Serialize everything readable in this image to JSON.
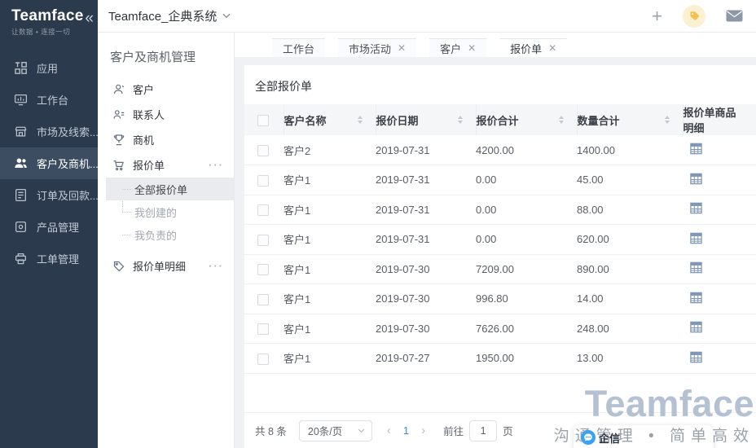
{
  "brand": {
    "logo": "Teamface",
    "tagline": "让数据 • 连接一切"
  },
  "topbar": {
    "title": "Teamface_企典系统"
  },
  "sidebar": {
    "items": [
      {
        "label": "应用",
        "icon": "apps-icon",
        "active": false
      },
      {
        "label": "工作台",
        "icon": "workbench-icon",
        "active": false
      },
      {
        "label": "市场及线索...",
        "icon": "market-icon",
        "active": false
      },
      {
        "label": "客户及商机...",
        "icon": "customers-icon",
        "active": true
      },
      {
        "label": "订单及回款...",
        "icon": "orders-icon",
        "active": false
      },
      {
        "label": "产品管理",
        "icon": "products-icon",
        "active": false
      },
      {
        "label": "工单管理",
        "icon": "tickets-icon",
        "active": false
      }
    ]
  },
  "submenu": {
    "title": "客户及商机管理",
    "items": [
      {
        "label": "客户"
      },
      {
        "label": "联系人"
      },
      {
        "label": "商机"
      },
      {
        "label": "报价单"
      },
      {
        "label": "报价单明细"
      }
    ],
    "children": [
      {
        "label": "全部报价单",
        "selected": true
      },
      {
        "label": "我创建的",
        "selected": false
      },
      {
        "label": "我负责的",
        "selected": false
      }
    ],
    "more_label": "···"
  },
  "tabs": [
    {
      "label": "工作台",
      "closable": false,
      "active": false
    },
    {
      "label": "市场活动",
      "closable": true,
      "active": false
    },
    {
      "label": "客户",
      "closable": true,
      "active": false
    },
    {
      "label": "报价单",
      "closable": true,
      "active": true
    }
  ],
  "main": {
    "title": "全部报价单",
    "table": {
      "columns": [
        {
          "label": "客户名称",
          "sortable": true
        },
        {
          "label": "报价日期",
          "sortable": true
        },
        {
          "label": "报价合计",
          "sortable": true
        },
        {
          "label": "数量合计",
          "sortable": true
        },
        {
          "label": "报价单商品明细",
          "sortable": false
        }
      ],
      "rows": [
        {
          "customer": "客户2",
          "date": "2019-07-31",
          "amount": "4200.00",
          "quantity": "1400.00"
        },
        {
          "customer": "客户1",
          "date": "2019-07-31",
          "amount": "0.00",
          "quantity": "45.00"
        },
        {
          "customer": "客户1",
          "date": "2019-07-31",
          "amount": "0.00",
          "quantity": "88.00"
        },
        {
          "customer": "客户1",
          "date": "2019-07-31",
          "amount": "0.00",
          "quantity": "620.00"
        },
        {
          "customer": "客户1",
          "date": "2019-07-30",
          "amount": "7209.00",
          "quantity": "890.00"
        },
        {
          "customer": "客户1",
          "date": "2019-07-30",
          "amount": "996.80",
          "quantity": "14.00"
        },
        {
          "customer": "客户1",
          "date": "2019-07-30",
          "amount": "7626.00",
          "quantity": "248.00"
        },
        {
          "customer": "客户1",
          "date": "2019-07-27",
          "amount": "1950.00",
          "quantity": "13.00"
        }
      ]
    },
    "pagination": {
      "total": "共 8 条",
      "page_size": "20条/页",
      "prev": "‹",
      "next": "›",
      "current": "1",
      "goto_label": "前往",
      "goto_value": "1",
      "page_unit": "页"
    }
  },
  "watermark": {
    "brand": "Teamface",
    "slogan": "沟通管理 • 简单高效"
  },
  "chat": {
    "label": "企信"
  },
  "colors": {
    "sidebar_bg": "#2b3a4c",
    "sidebar_active_bg": "#3d4d61",
    "accent_blue": "#3a8ee6",
    "tag_yellow": "#f3c14f",
    "watermark_blue": "#b4c1d2",
    "grid_icon_blue": "#7e97b7"
  }
}
